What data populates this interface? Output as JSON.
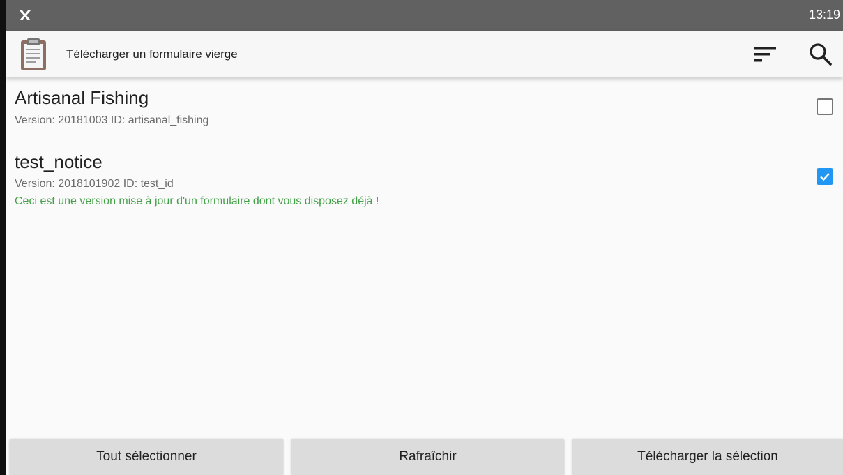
{
  "status_bar": {
    "time": "13:19",
    "notification_icon": "odk-collect-icon"
  },
  "app_bar": {
    "title": "Télécharger un formulaire vierge",
    "app_icon": "clipboard-icon",
    "sort_icon": "sort-icon",
    "search_icon": "search-icon"
  },
  "forms": [
    {
      "name": "Artisanal Fishing",
      "meta": "Version: 20181003 ID: artisanal_fishing",
      "notice": "",
      "checked": false
    },
    {
      "name": "test_notice",
      "meta": "Version: 2018101902 ID: test_id",
      "notice": "Ceci est une version mise à jour d'un formulaire dont vous disposez déjà !",
      "checked": true
    }
  ],
  "buttons": {
    "select_all": "Tout sélectionner",
    "refresh": "Rafraîchir",
    "download": "Télécharger la sélection"
  },
  "colors": {
    "status_bar": "#616161",
    "accent": "#2196f3",
    "notice_text": "#43a047"
  }
}
